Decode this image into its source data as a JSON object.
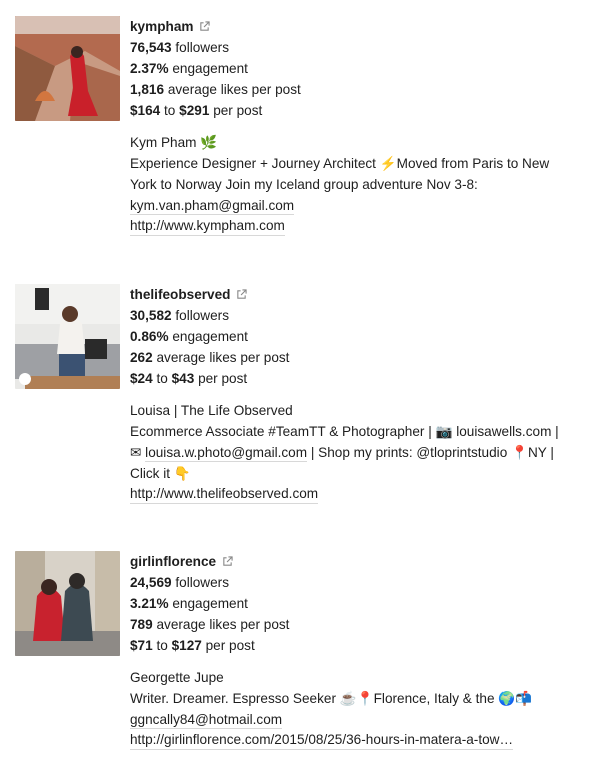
{
  "profiles": [
    {
      "handle": "kympham",
      "followers": "76,543",
      "followers_label": "followers",
      "engagement": "2.37%",
      "engagement_label": "engagement",
      "avg_likes": "1,816",
      "avg_likes_label": "average likes per post",
      "price_low": "$164",
      "price_to": "to",
      "price_high": "$291",
      "price_label": "per post",
      "name": "Kym Pham 🌿",
      "bio_a": "Experience Designer + Journey Architect ⚡️Moved from Paris to New York to Norway Join my Iceland group adventure Nov 3-8: ",
      "bio_email": "kym.van.pham@gmail.com",
      "bio_b": "",
      "website": "http://www.kympham.com",
      "thumb_icon": "profile-photo"
    },
    {
      "handle": "thelifeobserved",
      "followers": "30,582",
      "followers_label": "followers",
      "engagement": "0.86%",
      "engagement_label": "engagement",
      "avg_likes": "262",
      "avg_likes_label": "average likes per post",
      "price_low": "$24",
      "price_to": "to",
      "price_high": "$43",
      "price_label": "per post",
      "name": "Louisa | The Life Observed",
      "bio_a": "Ecommerce Associate #TeamTT & Photographer | 📷 louisawells.com | ✉ ",
      "bio_email": "louisa.w.photo@gmail.com",
      "bio_b": " | Shop my prints: @tloprintstudio 📍NY | Click it 👇",
      "website": "http://www.thelifeobserved.com",
      "thumb_icon": "profile-photo"
    },
    {
      "handle": "girlinflorence",
      "followers": "24,569",
      "followers_label": "followers",
      "engagement": "3.21%",
      "engagement_label": "engagement",
      "avg_likes": "789",
      "avg_likes_label": "average likes per post",
      "price_low": "$71",
      "price_to": "to",
      "price_high": "$127",
      "price_label": "per post",
      "name": "Georgette Jupe",
      "bio_a": "Writer. Dreamer. Espresso Seeker ☕️📍Florence, Italy & the 🌍📬",
      "bio_email": "ggncally84@hotmail.com",
      "bio_b": "",
      "website": "http://girlinflorence.com/2015/08/25/36-hours-in-matera-a-tow…",
      "thumb_icon": "profile-photo"
    }
  ],
  "icons": {
    "external": "external-link-icon"
  },
  "colors": {
    "text": "#1e1e1e",
    "underline": "#d8d8d8"
  }
}
